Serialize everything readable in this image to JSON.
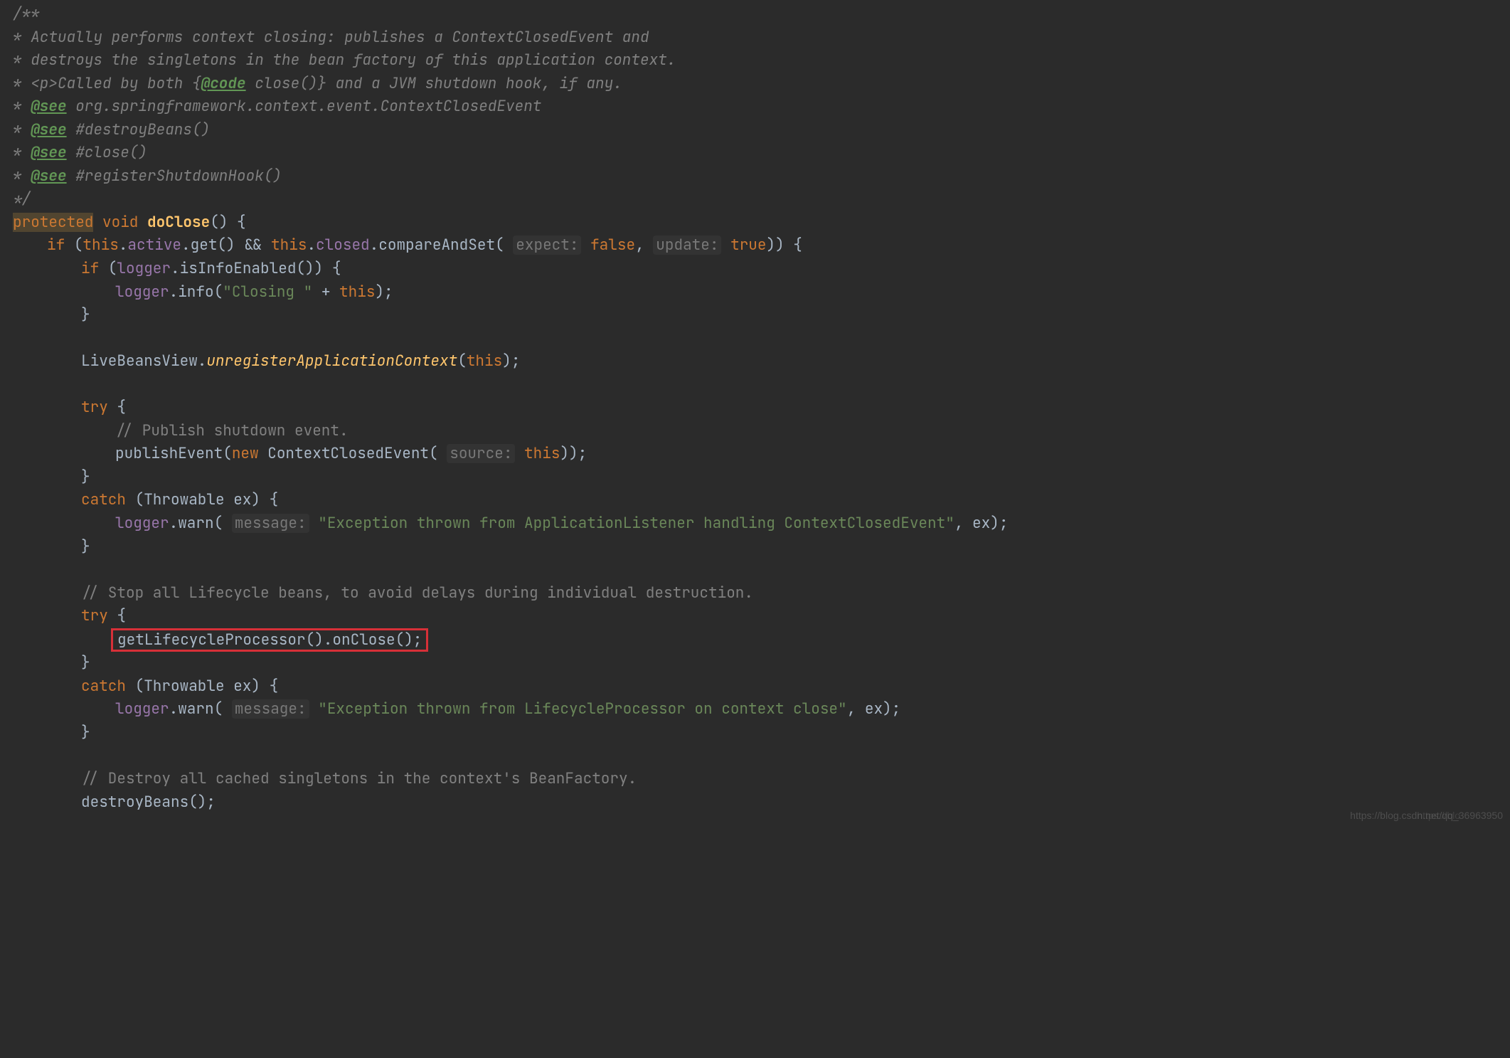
{
  "javadoc": {
    "open": "/**",
    "l1_prefix": " * ",
    "l1": "Actually performs context closing: publishes a ContextClosedEvent and",
    "l2_prefix": " * ",
    "l2": "destroys the singletons in the bean factory of this application context.",
    "l3_prefix": " * ",
    "l3_a": "<p>Called by both {",
    "l3_tag": "@code",
    "l3_b": " close()} and a JVM shutdown hook, if any.",
    "l4_prefix": " * ",
    "l4_tag": "@see",
    "l4": " org.springframework.context.event.ContextClosedEvent",
    "l5_prefix": " * ",
    "l5_tag": "@see",
    "l5": " #destroyBeans()",
    "l6_prefix": " * ",
    "l6_tag": "@see",
    "l6": " #close()",
    "l7_prefix": " * ",
    "l7_tag": "@see",
    "l7": " #registerShutdownHook()",
    "close": " */"
  },
  "sig": {
    "protected": "protected",
    "void": " void ",
    "name": "doClose",
    "tail": "() {"
  },
  "if1": {
    "if": "if",
    "open": " (",
    "this1": "this",
    "dot1": ".",
    "active": "active",
    "get": ".get() && ",
    "this2": "this",
    "dot2": ".",
    "closed": "closed",
    "cas": ".compareAndSet( ",
    "inlay1": "expect:",
    "sp1": " ",
    "false": "false",
    "comma": ",  ",
    "inlay2": "update:",
    "sp2": " ",
    "true": "true",
    "tail": ")) {"
  },
  "if2": {
    "if": "if",
    "open": " (",
    "logger": "logger",
    "call": ".isInfoEnabled()) {"
  },
  "log1": {
    "logger": "logger",
    "info": ".info(",
    "str": "\"Closing \"",
    "plus": " + ",
    "this": "this",
    "end": ");"
  },
  "brace": "}",
  "lbv": {
    "a": "LiveBeansView.",
    "m": "unregisterApplicationContext",
    "open": "(",
    "this": "this",
    "end": ");"
  },
  "try": "try",
  "tryOpen": " {",
  "cmt1": "// Publish shutdown event.",
  "pub": {
    "a": "publishEvent(",
    "new": "new",
    "b": " ContextClosedEvent( ",
    "inlay": "source:",
    "sp": " ",
    "this": "this",
    "end": "));"
  },
  "catch": "catch",
  "catch1tail": " (Throwable ex) {",
  "warn1": {
    "logger": "logger",
    "warn": ".warn( ",
    "inlay": "message:",
    "sp": " ",
    "str": "\"Exception thrown from ApplicationListener handling ContextClosedEvent\"",
    "end": ", ex);"
  },
  "cmt2": "// Stop all Lifecycle beans, to avoid delays during individual destruction.",
  "boxed": "getLifecycleProcessor().onClose();",
  "warn2": {
    "logger": "logger",
    "warn": ".warn( ",
    "inlay": "message:",
    "sp": " ",
    "str": "\"Exception thrown from LifecycleProcessor on context close\"",
    "end": ", ex);"
  },
  "cmt3": "// Destroy all cached singletons in the context's BeanFactory.",
  "destroy": "destroyBeans();",
  "watermark": "https://blog.csdn.net/qq_36963950",
  "watermark2": "https://blo"
}
